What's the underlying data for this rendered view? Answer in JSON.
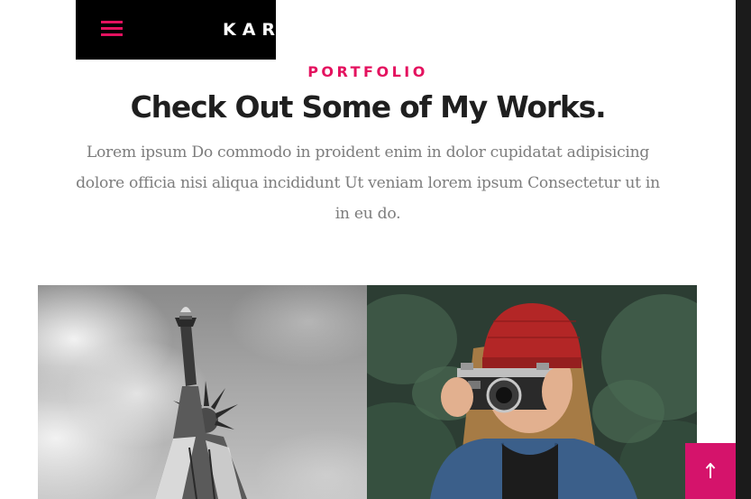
{
  "header": {
    "logo_text": "KARDS",
    "menu_icon": "hamburger-menu-icon"
  },
  "section": {
    "eyebrow": "PORTFOLIO",
    "title": "Check Out Some of My Works.",
    "description": "Lorem ipsum Do commodo in proident enim in dolor cupidatat adipisicing dolore officia nisi aliqua incididunt Ut veniam lorem ipsum Consectetur ut in in eu do."
  },
  "gallery": {
    "items": [
      {
        "icon": "statue-of-liberty-photo"
      },
      {
        "icon": "woman-with-camera-photo"
      }
    ]
  },
  "back_to_top": {
    "icon": "arrow-up-icon"
  },
  "colors": {
    "accent": "#e4125f",
    "back_to_top_bg": "#d5136b",
    "header_bg": "#000000",
    "heading": "#1f1f1f",
    "body_text": "#7d7d7d",
    "right_rail": "#1b1b1b"
  }
}
